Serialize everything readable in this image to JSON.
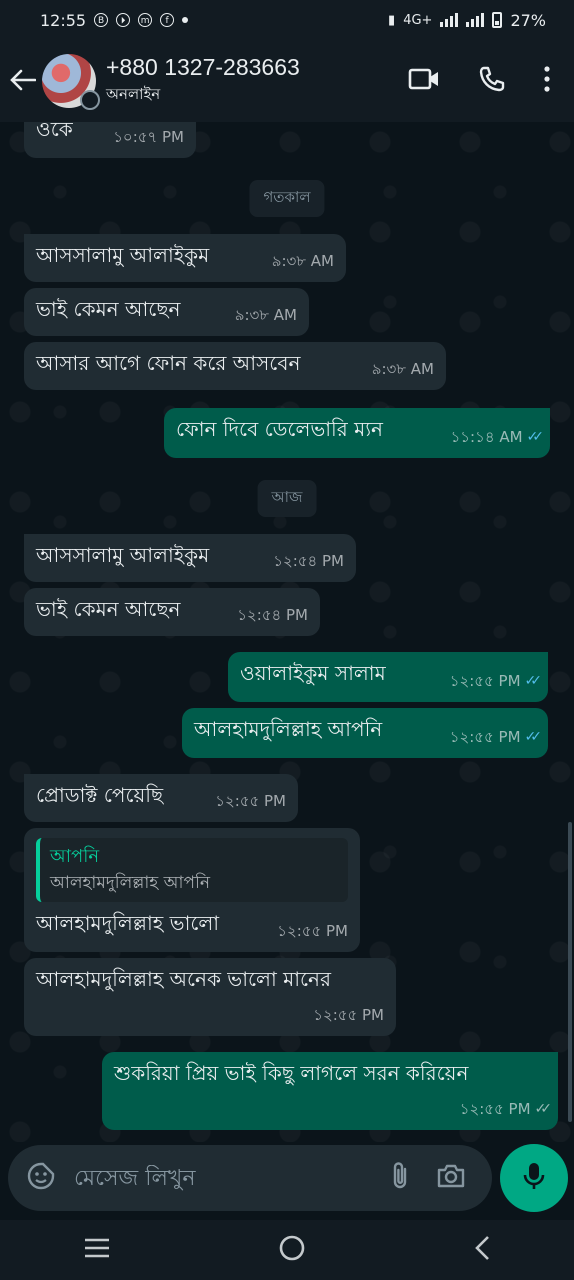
{
  "status_bar": {
    "time": "12:55",
    "network": "4G+",
    "battery": "27%",
    "left_icons": [
      "B",
      "⏵",
      "m",
      "f"
    ]
  },
  "header": {
    "contact_name": "+880 1327-283663",
    "status": "অনলাইন"
  },
  "date_labels": {
    "yesterday": "গতকাল",
    "today": "আজ"
  },
  "messages": [
    {
      "dir": "in",
      "text": "ওকে",
      "time": "১০:৫৭ PM"
    },
    {
      "dir": "in",
      "text": "আসসালামু আলাইকুম",
      "time": "৯:৩৮ AM"
    },
    {
      "dir": "in",
      "text": "ভাই কেমন আছেন",
      "time": "৯:৩৮ AM"
    },
    {
      "dir": "in",
      "text": "আসার আগে ফোন করে আসবেন",
      "time": "৯:৩৮ AM"
    },
    {
      "dir": "out",
      "text": "ফোন দিবে ডেলেভারি ম্যন",
      "time": "১১:১৪ AM",
      "read": true
    },
    {
      "dir": "in",
      "text": "আসসালামু আলাইকুম",
      "time": "১২:৫৪ PM"
    },
    {
      "dir": "in",
      "text": "ভাই কেমন আছেন",
      "time": "১২:৫৪ PM"
    },
    {
      "dir": "out",
      "text": "ওয়ালাইকুম সালাম",
      "time": "১২:৫৫ PM",
      "read": true
    },
    {
      "dir": "out",
      "text": "আলহামদুলিল্লাহ আপনি",
      "time": "১২:৫৫ PM",
      "read": true
    },
    {
      "dir": "in",
      "text": "প্রোডাক্ট পেয়েছি",
      "time": "১২:৫৫ PM"
    },
    {
      "dir": "in",
      "text": "আলহামদুলিল্লাহ ভালো",
      "time": "১২:৫৫ PM",
      "quote_author": "আপনি",
      "quote_text": "আলহামদুলিল্লাহ আপনি"
    },
    {
      "dir": "in",
      "text": "আলহামদুলিল্লাহ অনেক ভালো মানের",
      "time": "১২:৫৫ PM"
    },
    {
      "dir": "out",
      "text": "শুকরিয়া প্রিয় ভাই কিছু লাগলে সরন করিয়েন",
      "time": "১২:৫৫ PM",
      "read": false
    }
  ],
  "input": {
    "placeholder": "মেসেজ লিখুন"
  },
  "colors": {
    "incoming": "#202c33",
    "outgoing": "#005c4b",
    "accent": "#00a884",
    "read_tick": "#53bdeb"
  }
}
